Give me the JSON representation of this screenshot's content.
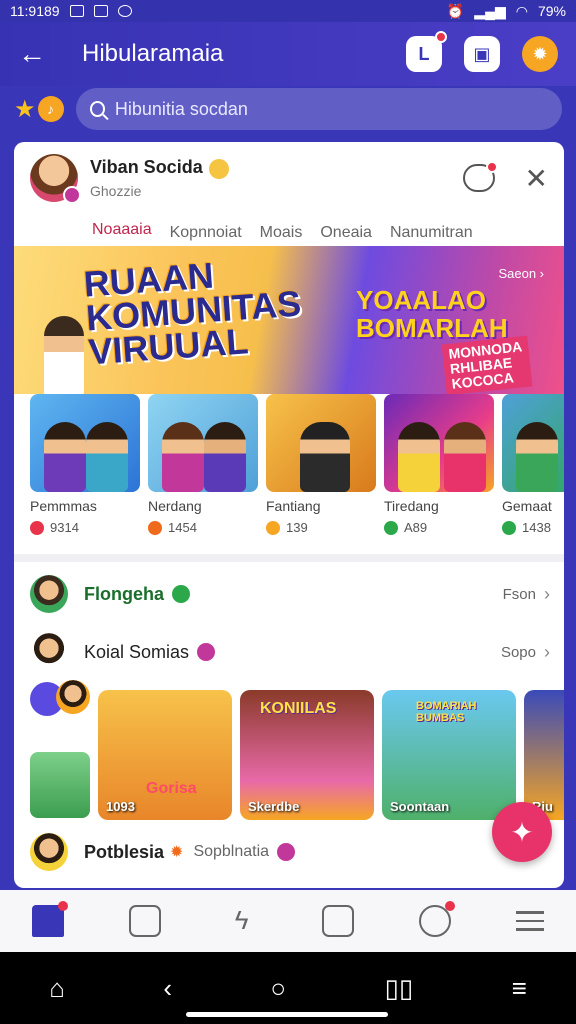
{
  "status_bar": {
    "time": "11:9189",
    "battery": "79%"
  },
  "header": {
    "title": "Hibularamaia",
    "back_icon": "arrow-left-icon",
    "icons": [
      "notification-icon",
      "bookmark-icon",
      "gear-icon"
    ]
  },
  "search": {
    "placeholder": "Hibunitia socdan"
  },
  "profile": {
    "name": "Viban Socida",
    "subtitle": "Ghozzie"
  },
  "tabs": [
    "Noaaaia",
    "Kopnnoiat",
    "Moais",
    "Oneaia",
    "Nanumitran"
  ],
  "banner": {
    "title_line1": "RUAAN",
    "title_line2": "KOMUNITAS",
    "title_line3": "VIRUUAL",
    "right_line1": "YOAALAO",
    "right_line2": "BOMARLAH",
    "tag_line1": "MONNODA",
    "tag_line2": "RHLIBAE",
    "tag_line3": "KOCOCA",
    "see_all": "Saeon"
  },
  "thumbnails": [
    {
      "name": "Pemmmas",
      "count": "9314",
      "color": "#e8334a"
    },
    {
      "name": "Nerdang",
      "count": "1454",
      "color": "#f06a1c"
    },
    {
      "name": "Fantiang",
      "count": "139",
      "color": "#f6a623"
    },
    {
      "name": "Tiredang",
      "count": "A89",
      "color": "#2aa84a"
    },
    {
      "name": "Gemaat",
      "count": "1438",
      "color": "#2aa84a"
    }
  ],
  "feed": {
    "row1": {
      "name": "Flongeha",
      "side": "Fson"
    },
    "row2": {
      "name": "Koial Somias",
      "side": "Sopo"
    },
    "gallery": [
      {
        "label": "1093",
        "sign": "Gorisa"
      },
      {
        "label": "Skerdbe",
        "sign": "KONIILAS"
      },
      {
        "label": "Soontaan",
        "sign": "BOMARIAH BUMBAS"
      },
      {
        "label": "Riu",
        "sign": ""
      }
    ],
    "row3": {
      "name": "Potblesia",
      "side": "Sopblnatia"
    }
  },
  "bottom_nav": [
    "home-icon",
    "camera-icon",
    "lightning-icon",
    "photo-icon",
    "chat-icon",
    "menu-icon"
  ]
}
